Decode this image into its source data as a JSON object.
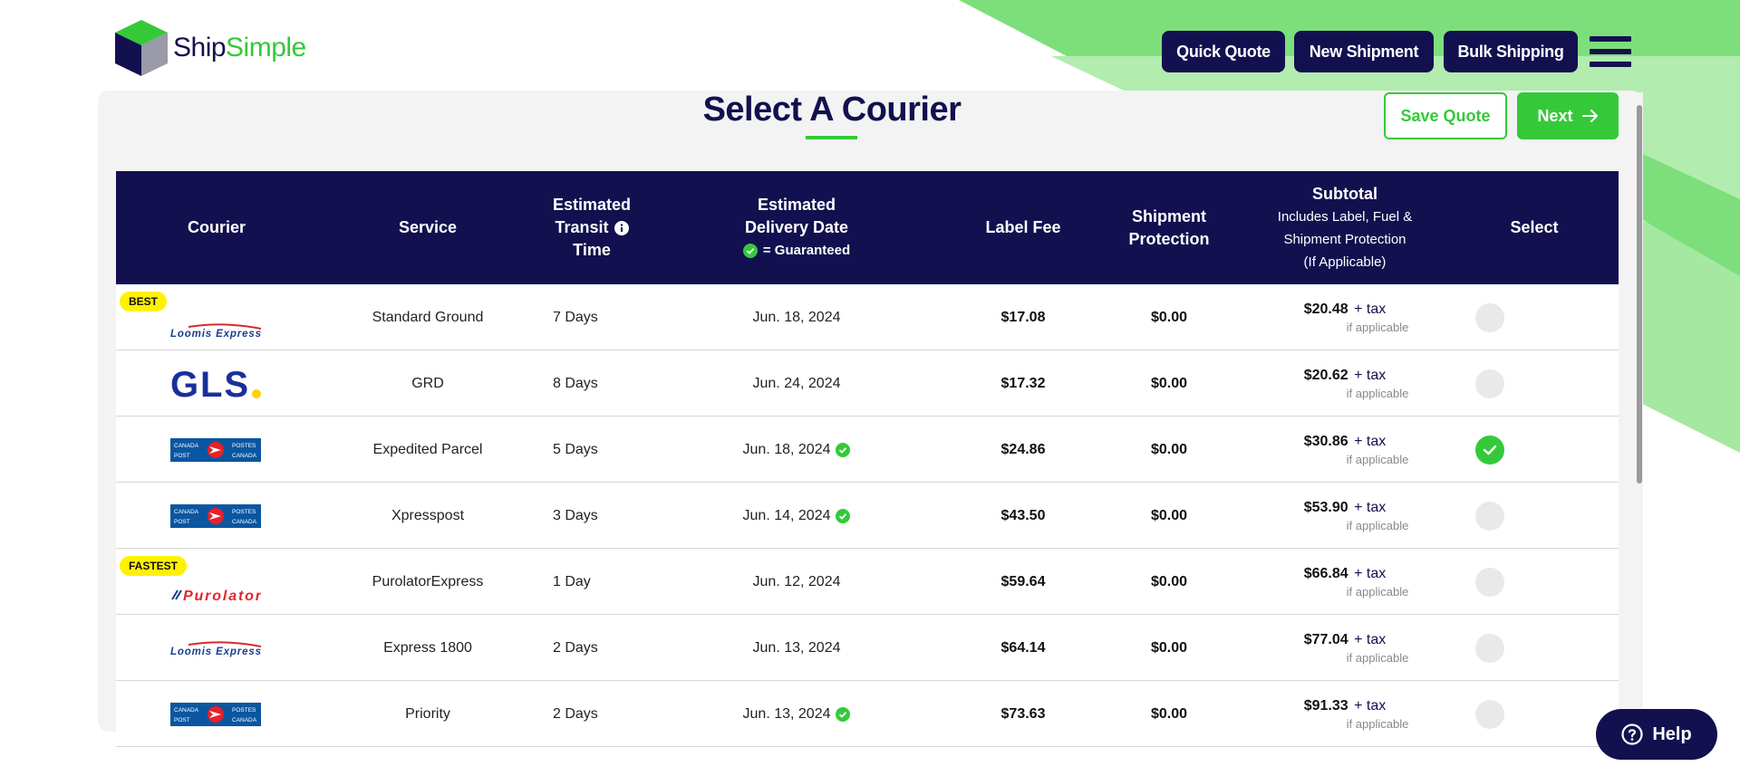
{
  "brand": {
    "name_part1": "Ship",
    "name_part2": "Simple"
  },
  "header": {
    "buttons": [
      {
        "label": "Quick Quote"
      },
      {
        "label": "New Shipment"
      },
      {
        "label": "Bulk Shipping"
      }
    ]
  },
  "page": {
    "title": "Select A Courier",
    "save_label": "Save Quote",
    "next_label": "Next"
  },
  "table": {
    "headers": {
      "courier": "Courier",
      "service": "Service",
      "transit_1": "Estimated",
      "transit_2": "Transit",
      "transit_3": "Time",
      "delivery_1": "Estimated",
      "delivery_2": "Delivery Date",
      "delivery_guaranteed": "= Guaranteed",
      "label_fee": "Label Fee",
      "protection_1": "Shipment",
      "protection_2": "Protection",
      "subtotal_title": "Subtotal",
      "subtotal_sub1": "Includes Label, Fuel &",
      "subtotal_sub2": "Shipment Protection",
      "subtotal_sub3": "(If Applicable)",
      "select": "Select"
    },
    "tax_suffix": "+ tax",
    "if_applicable": "if applicable",
    "rows": [
      {
        "badge": "BEST",
        "courier": "Loomis Express",
        "logo": "loomis",
        "service": "Standard Ground",
        "transit": "7 Days",
        "delivery": "Jun. 18, 2024",
        "guaranteed": false,
        "label_fee": "$17.08",
        "protection": "$0.00",
        "subtotal": "$20.48",
        "selected": false
      },
      {
        "badge": "",
        "courier": "GLS",
        "logo": "gls",
        "service": "GRD",
        "transit": "8 Days",
        "delivery": "Jun. 24, 2024",
        "guaranteed": false,
        "label_fee": "$17.32",
        "protection": "$0.00",
        "subtotal": "$20.62",
        "selected": false
      },
      {
        "badge": "",
        "courier": "Canada Post",
        "logo": "canadapost",
        "service": "Expedited Parcel",
        "transit": "5 Days",
        "delivery": "Jun. 18, 2024",
        "guaranteed": true,
        "label_fee": "$24.86",
        "protection": "$0.00",
        "subtotal": "$30.86",
        "selected": true
      },
      {
        "badge": "",
        "courier": "Canada Post",
        "logo": "canadapost",
        "service": "Xpresspost",
        "transit": "3 Days",
        "delivery": "Jun. 14, 2024",
        "guaranteed": true,
        "label_fee": "$43.50",
        "protection": "$0.00",
        "subtotal": "$53.90",
        "selected": false
      },
      {
        "badge": "FASTEST",
        "courier": "Purolator",
        "logo": "purolator",
        "service": "PurolatorExpress",
        "transit": "1 Day",
        "delivery": "Jun. 12, 2024",
        "guaranteed": false,
        "label_fee": "$59.64",
        "protection": "$0.00",
        "subtotal": "$66.84",
        "selected": false
      },
      {
        "badge": "",
        "courier": "Loomis Express",
        "logo": "loomis",
        "service": "Express 1800",
        "transit": "2 Days",
        "delivery": "Jun. 13, 2024",
        "guaranteed": false,
        "label_fee": "$64.14",
        "protection": "$0.00",
        "subtotal": "$77.04",
        "selected": false
      },
      {
        "badge": "",
        "courier": "Canada Post",
        "logo": "canadapost",
        "service": "Priority",
        "transit": "2 Days",
        "delivery": "Jun. 13, 2024",
        "guaranteed": true,
        "label_fee": "$73.63",
        "protection": "$0.00",
        "subtotal": "$91.33",
        "selected": false
      }
    ]
  },
  "help": {
    "label": "Help"
  },
  "colors": {
    "navy": "#131050",
    "green": "#35c93a",
    "badge_yellow": "#fff200"
  }
}
